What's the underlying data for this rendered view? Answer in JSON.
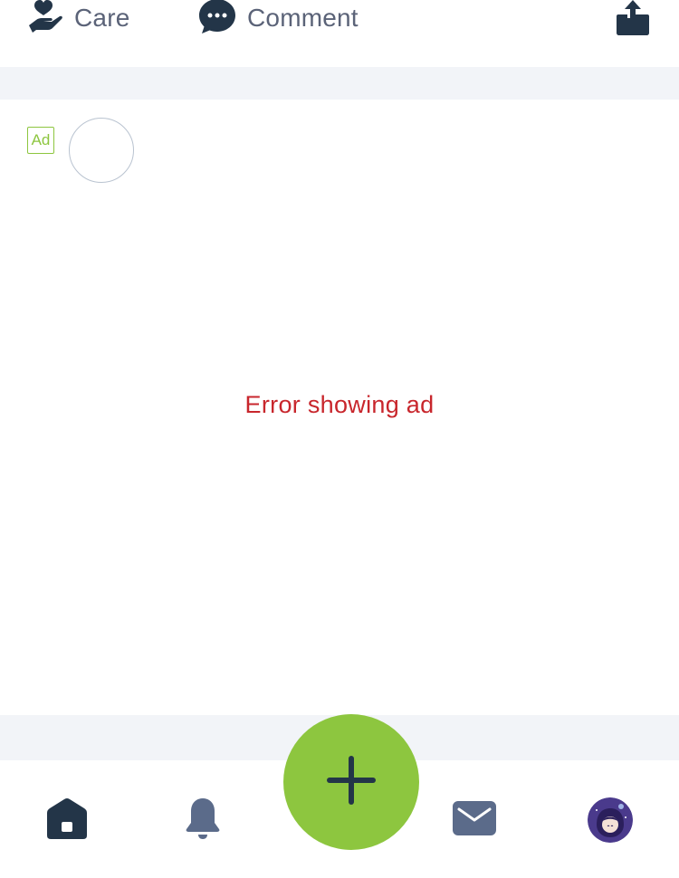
{
  "actions": {
    "care_label": "Care",
    "comment_label": "Comment"
  },
  "ad": {
    "badge": "Ad",
    "error_text": "Error showing ad"
  },
  "bottom_nav": {
    "items": [
      {
        "icon": "home-icon",
        "active": true
      },
      {
        "icon": "bell-icon",
        "active": false
      },
      {
        "icon": "plus-icon",
        "active": false
      },
      {
        "icon": "mail-icon",
        "active": false
      },
      {
        "icon": "profile-avatar",
        "active": false
      }
    ]
  },
  "colors": {
    "accent_green": "#8dc63f",
    "icon_dark": "#233548",
    "icon_muted": "#5b6b8a",
    "error_red": "#c8262c",
    "separator": "#f2f4f8"
  }
}
